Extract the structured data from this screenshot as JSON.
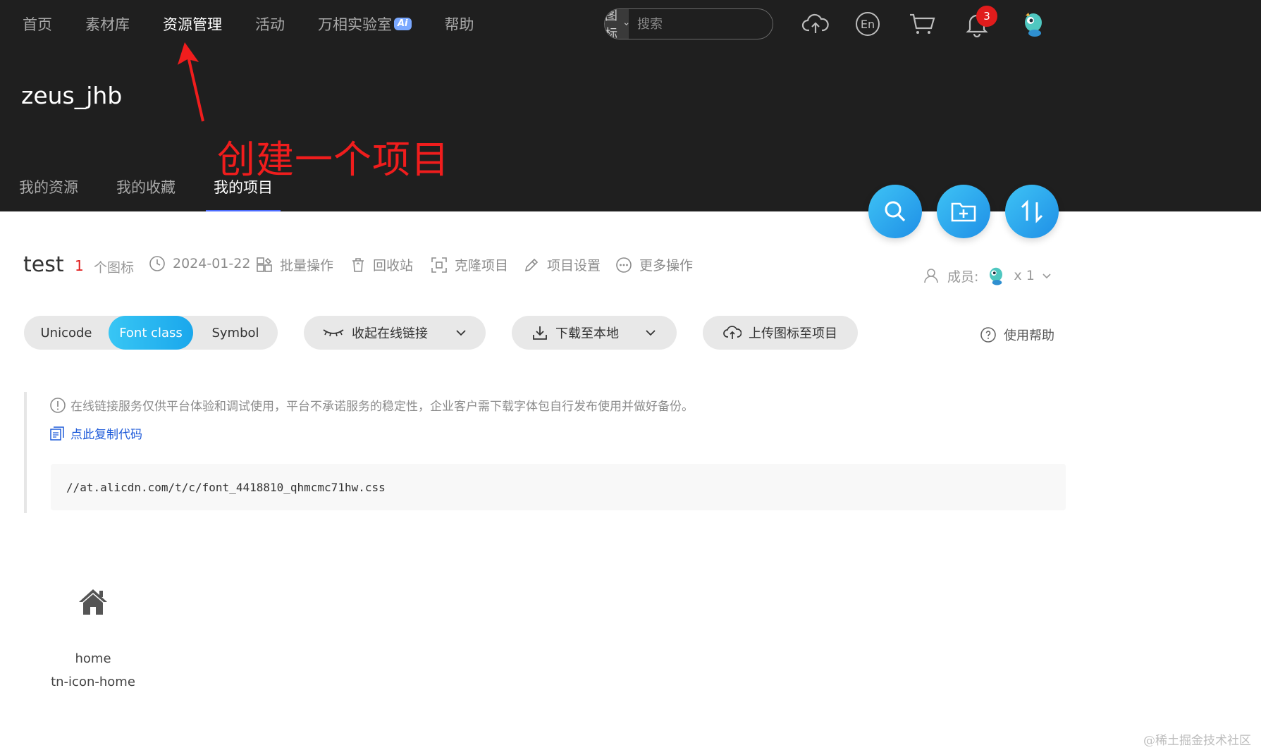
{
  "topnav": {
    "items": [
      "首页",
      "素材库",
      "资源管理",
      "活动",
      "万相实验室",
      "帮助"
    ],
    "ai_badge": "Ai",
    "active_index": 2
  },
  "search": {
    "type_label": "图标",
    "placeholder": "搜索"
  },
  "header": {
    "notification_count": "3",
    "username": "zeus_jhb"
  },
  "annotation": {
    "text": "创建一个项目",
    "color": "#f01d1d"
  },
  "subnav": {
    "items": [
      "我的资源",
      "我的收藏",
      "我的项目"
    ],
    "active_index": 2
  },
  "project": {
    "name": "test",
    "icon_count": "1",
    "icon_count_label": "个图标",
    "date": "2024-01-22",
    "actions": {
      "batch": "批量操作",
      "recycle": "回收站",
      "clone": "克隆项目",
      "settings": "项目设置",
      "more": "更多操作"
    },
    "members_label": "成员:",
    "members_count": "x 1"
  },
  "toolbar": {
    "modes": [
      "Unicode",
      "Font class",
      "Symbol"
    ],
    "active_mode": "Font class",
    "collapse_link": "收起在线链接",
    "download": "下载至本地",
    "upload": "上传图标至项目",
    "help": "使用帮助"
  },
  "notice": {
    "text": "在线链接服务仅供平台体验和调试使用，平台不承诺服务的稳定性，企业客户需下载字体包自行发布使用并做好备份。",
    "copy_label": "点此复制代码",
    "code": "//at.alicdn.com/t/c/font_4418810_qhmcmc71hw.css"
  },
  "icons": [
    {
      "name": "home",
      "class_name": "tn-icon-home",
      "glyph": "home-icon"
    }
  ],
  "colors": {
    "header_bg": "#1f1f1f",
    "accent_blue": "#1aa7ec",
    "danger_red": "#e11c1c",
    "link_blue": "#1f5bd9"
  },
  "watermark": "@稀土掘金技术社区"
}
